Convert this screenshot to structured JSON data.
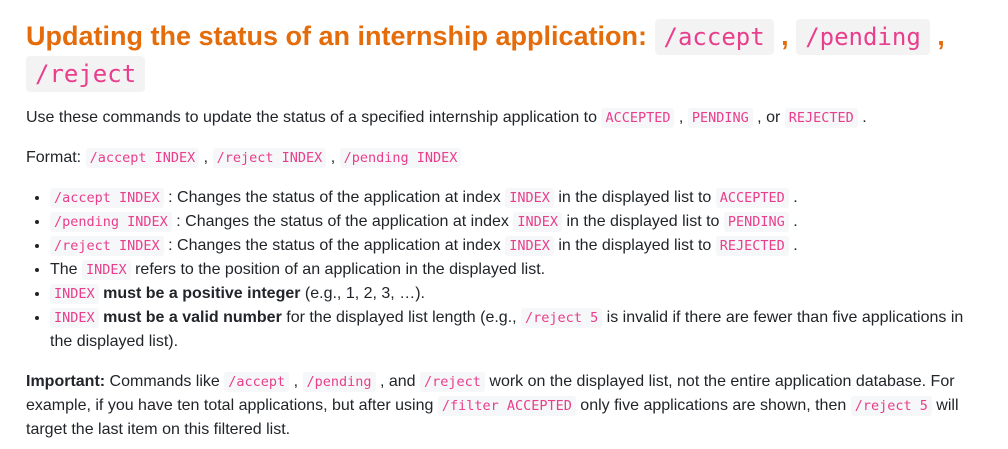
{
  "heading": {
    "text": "Updating the status of an internship application: ",
    "cmd_accept": "/accept",
    "sep1": " , ",
    "cmd_pending": "/pending",
    "sep2": " ,",
    "cmd_reject": "/reject"
  },
  "intro": {
    "t1": "Use these commands to update the status of a specified internship application to ",
    "c1": "ACCEPTED",
    "t2": " , ",
    "c2": "PENDING",
    "t3": " , or ",
    "c3": "REJECTED",
    "t4": " ."
  },
  "format": {
    "label": "Format: ",
    "c1": "/accept INDEX",
    "t1": " , ",
    "c2": "/reject INDEX",
    "t2": " , ",
    "c3": "/pending INDEX"
  },
  "bullets": {
    "b1": {
      "cmd": "/accept INDEX",
      "t1": " : Changes the status of the application at index ",
      "idx": "INDEX",
      "t2": " in the displayed list to ",
      "status": "ACCEPTED",
      "t3": " ."
    },
    "b2": {
      "cmd": "/pending INDEX",
      "t1": " : Changes the status of the application at index ",
      "idx": "INDEX",
      "t2": " in the displayed list to ",
      "status": "PENDING",
      "t3": " ."
    },
    "b3": {
      "cmd": "/reject INDEX",
      "t1": " : Changes the status of the application at index ",
      "idx": "INDEX",
      "t2": " in the displayed list to ",
      "status": "REJECTED",
      "t3": " ."
    },
    "b4": {
      "t1": "The ",
      "idx": "INDEX",
      "t2": " refers to the position of an application in the displayed list."
    },
    "b5": {
      "idx": "INDEX",
      "bold": " must be a positive integer",
      "t1": " (e.g., 1, 2, 3, …)."
    },
    "b6": {
      "idx": "INDEX",
      "bold": " must be a valid number",
      "t1": " for the displayed list length (e.g., ",
      "code": "/reject 5",
      "t2": " is invalid if there are fewer than five applications in the displayed list)."
    }
  },
  "important": {
    "label": "Important:",
    "t1": " Commands like ",
    "c1": "/accept",
    "t2": " , ",
    "c2": "/pending",
    "t3": " , and ",
    "c3": "/reject",
    "t4": " work on the displayed list, not the entire application database. For example, if you have ten total applications, but after using ",
    "c4": "/filter ACCEPTED",
    "t5": " only five applications are shown, then ",
    "c5": "/reject 5",
    "t6": " will target the last item on this filtered list."
  },
  "colors": {
    "heading": "#e46c0a",
    "code_text": "#e83e8c",
    "code_bg": "#f6f7f8",
    "body_text": "#212529"
  }
}
